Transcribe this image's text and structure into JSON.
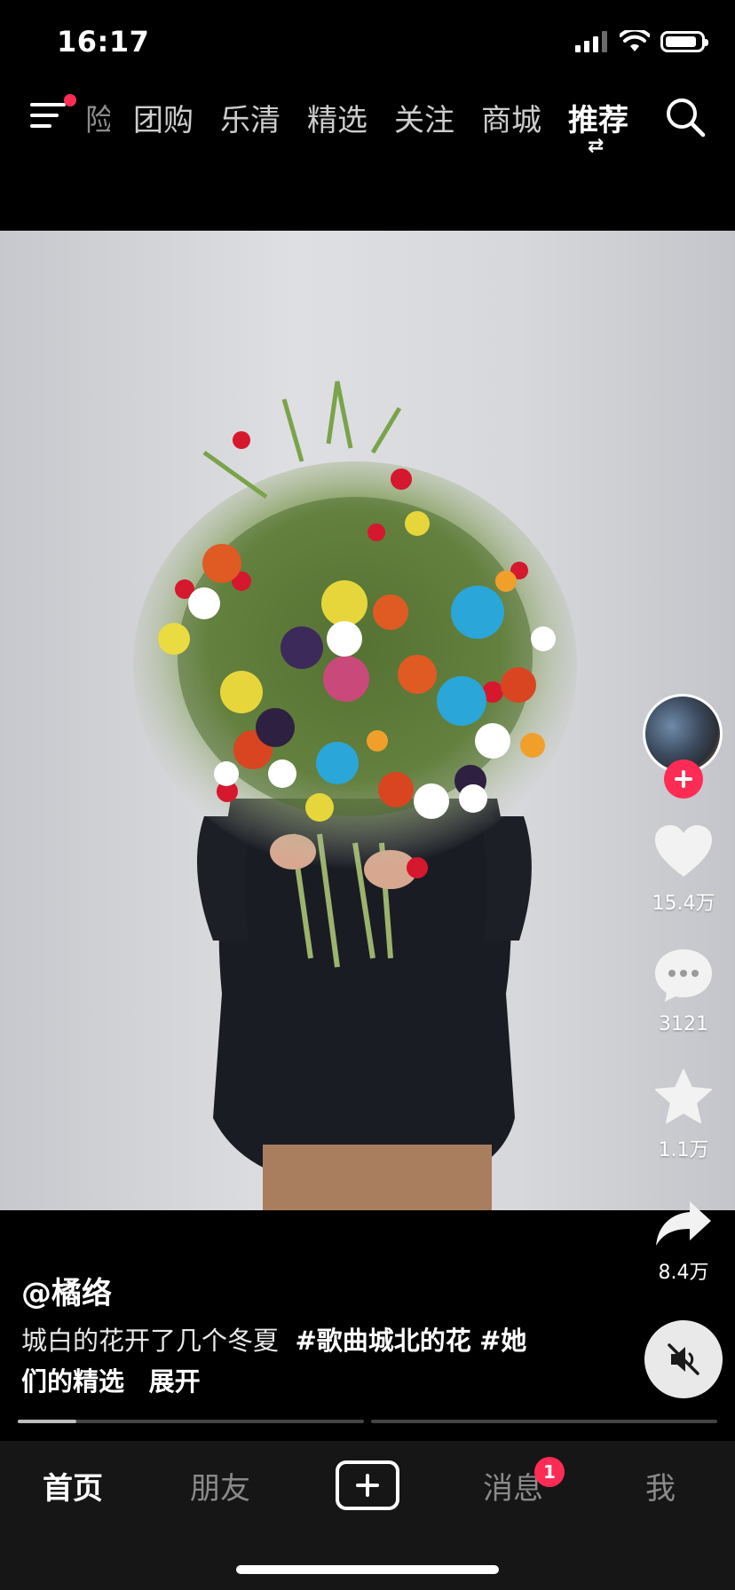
{
  "status_bar": {
    "time": "16:17",
    "icons": [
      "signal-icon",
      "wifi-icon",
      "battery-icon"
    ]
  },
  "top_nav": {
    "menu_icon": "menu-icon",
    "tabs": [
      {
        "label": "险"
      },
      {
        "label": "团购"
      },
      {
        "label": "乐清"
      },
      {
        "label": "精选"
      },
      {
        "label": "关注"
      },
      {
        "label": "商城"
      },
      {
        "label": "推荐",
        "sub": "⇄"
      }
    ],
    "search_icon": "search-icon"
  },
  "side_actions": {
    "likes": "15.4万",
    "comments": "3121",
    "favorites": "1.1万",
    "shares": "8.4万"
  },
  "post": {
    "author": "@橘络",
    "caption_text": "城白的花开了几个冬夏",
    "hashtag_1": "#歌曲城北的花",
    "hashtag_2_part1": "#她",
    "hashtag_2_part2": "们的精选",
    "expand": "展开"
  },
  "progress": {
    "segments": 2,
    "current_segment_fraction": 0.17
  },
  "bottom_nav": {
    "items": [
      {
        "label": "首页"
      },
      {
        "label": "朋友"
      },
      {
        "label": "+"
      },
      {
        "label": "消息",
        "badge": "1"
      },
      {
        "label": "我"
      }
    ]
  },
  "colors": {
    "accent": "#fe2c55",
    "background": "#000000",
    "tabbar": "#161616"
  }
}
